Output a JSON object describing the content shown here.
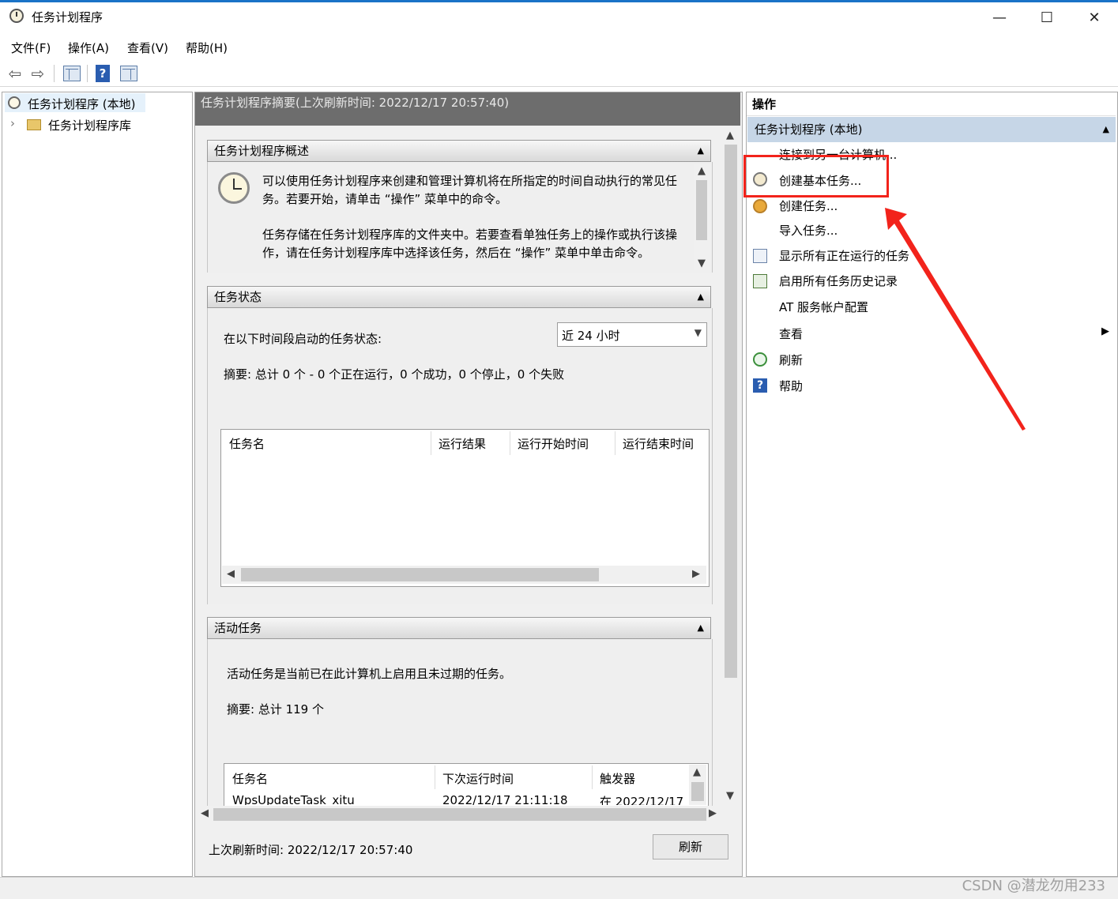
{
  "window": {
    "title": "任务计划程序",
    "minimize": "—",
    "maximize": "☐",
    "close": "✕"
  },
  "menu": [
    "文件(F)",
    "操作(A)",
    "查看(V)",
    "帮助(H)"
  ],
  "toolbar": {
    "back": "⇦",
    "forward": "⇨",
    "help": "?"
  },
  "tree": {
    "root": "任务计划程序 (本地)",
    "child": "任务计划程序库",
    "expander": "›"
  },
  "main": {
    "header": "任务计划程序摘要(上次刷新时间: 2022/12/17 20:57:40)",
    "overview": {
      "title": "任务计划程序概述",
      "p1": "可以使用任务计划程序来创建和管理计算机将在所指定的时间自动执行的常见任务。若要开始，请单击 “操作” 菜单中的命令。",
      "p2": "任务存储在任务计划程序库的文件夹中。若要查看单独任务上的操作或执行该操作，请在任务计划程序库中选择该任务，然后在 “操作” 菜单中单击命令。"
    },
    "status": {
      "title": "任务状态",
      "label": "在以下时间段启动的任务状态:",
      "period": "近 24 小时",
      "summary": "摘要: 总计 0 个 - 0 个正在运行，0 个成功，0 个停止，0 个失败",
      "columns": [
        "任务名",
        "运行结果",
        "运行开始时间",
        "运行结束时间"
      ]
    },
    "active": {
      "title": "活动任务",
      "desc": "活动任务是当前已在此计算机上启用且未过期的任务。",
      "summary": "摘要: 总计 119 个",
      "columns": [
        "任务名",
        "下次运行时间",
        "触发器"
      ],
      "rows": [
        {
          "name": "WpsUpdateTask_xitu",
          "next": "2022/12/17 21:11:18",
          "trigger": "在 2022/12/17"
        }
      ]
    },
    "footer": {
      "last_refresh": "上次刷新时间: 2022/12/17 20:57:40",
      "refresh_button": "刷新"
    }
  },
  "actions": {
    "title": "操作",
    "group": "任务计划程序 (本地)",
    "items": [
      "连接到另一台计算机...",
      "创建基本任务...",
      "创建任务...",
      "导入任务...",
      "显示所有正在运行的任务",
      "启用所有任务历史记录",
      "AT 服务帐户配置",
      "查看",
      "刷新",
      "帮助"
    ]
  },
  "watermark": "CSDN @潜龙勿用233",
  "colors": {
    "highlight": "#f2231b",
    "group_bg": "#c6d6e7",
    "header_bg": "#6d6d6d"
  }
}
